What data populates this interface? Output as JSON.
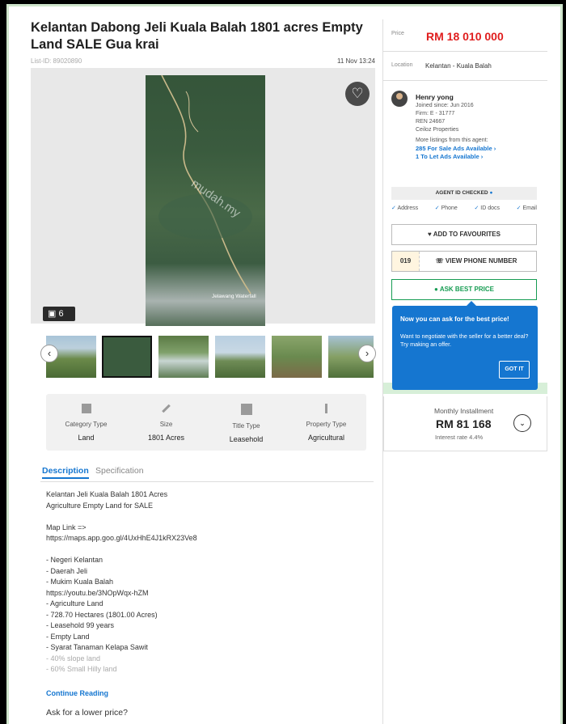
{
  "listing": {
    "title": "Kelantan Dabong Jeli Kuala Balah 1801 acres Empty Land SALE Gua krai",
    "list_id": "List-ID: 89020890",
    "posted": "11 Nov 13:24",
    "photo_count": "6",
    "photo_watermark": "mudah.my",
    "map_label": "Jelawang Waterfall"
  },
  "properties": [
    {
      "label": "Category Type",
      "value": "Land",
      "icon": "building-icon"
    },
    {
      "label": "Size",
      "value": "1801 Acres",
      "icon": "ruler-icon"
    },
    {
      "label": "Title Type",
      "value": "Leasehold",
      "icon": "document-icon"
    },
    {
      "label": "Property Type",
      "value": "Agricultural",
      "icon": "land-icon"
    }
  ],
  "tabs": {
    "description": "Description",
    "specification": "Specification"
  },
  "description": {
    "lines": [
      "Kelantan Jeli Kuala Balah 1801 Acres",
      "Agriculture Empty Land for SALE",
      "",
      "Map Link =>",
      "https://maps.app.goo.gl/4UxHhE4J1kRX23Ve8",
      "",
      "- Negeri Kelantan",
      "- Daerah Jeli",
      "- Mukim Kuala Balah",
      "https://youtu.be/3NOpWqx-hZM",
      "- Agriculture Land",
      "- 728.70 Hectares (1801.00 Acres)",
      "- Leasehold 99 years",
      "- Empty Land",
      "- Syarat Tanaman Kelapa Sawit"
    ],
    "fade_lines": [
      "- 40% slope land",
      "- 60% Small Hilly land"
    ],
    "continue": "Continue Reading",
    "ask_lower": "Ask for a lower price?"
  },
  "sidebar": {
    "price_label": "Price",
    "price": "RM 18 010 000",
    "location_label": "Location",
    "location": "Kelantan - Kuala Balah",
    "agent": {
      "name": "Henry yong",
      "joined": "Joined since: Jun 2016",
      "firm": "Firm: E - 31777",
      "ren": "REN 24667",
      "company": "Ceiloz Properties",
      "more": "More listings from this agent:",
      "sale_link": "285 For Sale Ads Available  ›",
      "let_link": "1 To Let Ads Available  ›"
    },
    "id_checked": "AGENT ID CHECKED",
    "checks": [
      "Address",
      "Phone",
      "ID docs",
      "Email"
    ],
    "fav": "ADD TO FAVOURITES",
    "phone_prefix": "019",
    "phone": "VIEW PHONE NUMBER",
    "ask": "ASK BEST PRICE",
    "accent": "#e01e1e",
    "brand_green": "#169c52",
    "link_blue": "#1576d0"
  },
  "tooltip": {
    "title": "Now you can ask for the best price!",
    "body": "Want to negotiate with the seller for a better deal? Try making an offer.",
    "button": "GOT IT"
  },
  "installment": {
    "label": "Monthly Installment",
    "value": "RM 81 168",
    "rate": "Interest rate 4.4%"
  }
}
